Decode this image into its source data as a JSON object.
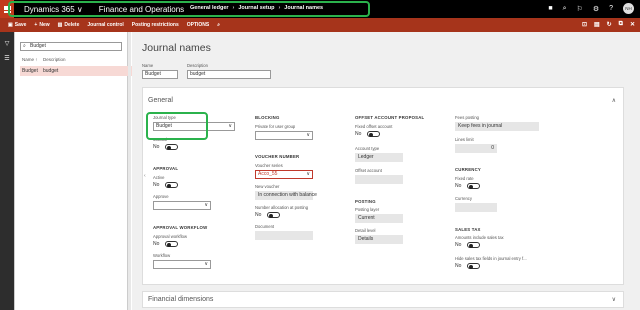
{
  "topbar": {
    "brand": "Dynamics 365",
    "brand_chevron": "∨",
    "module": "Finance and Operations",
    "breadcrumb": [
      "General ledger",
      "Journal setup",
      "Journal names"
    ],
    "avatar": "NH"
  },
  "actionbar": {
    "save": "Save",
    "new": "New",
    "delete": "Delete",
    "journal_control": "Journal control",
    "posting_restrictions": "Posting restrictions",
    "options": "OPTIONS"
  },
  "list": {
    "filter_value": "Budget",
    "col_name": "Name ↑",
    "col_desc": "Description",
    "rows": [
      {
        "name": "Budget",
        "description": "budget"
      }
    ]
  },
  "main": {
    "title": "Journal names",
    "name_label": "Name",
    "name_value": "Budget",
    "desc_label": "Description",
    "desc_value": "budget",
    "general": {
      "title": "General",
      "caret": "∧",
      "journal_type_label": "Journal type",
      "journal_type_value": "Budget",
      "manual_label": "Manual",
      "manual_value": "No",
      "approval_title": "APPROVAL",
      "active_label": "Active",
      "active_value": "No",
      "approve_label": "Approve",
      "approval_workflow_title": "APPROVAL WORKFLOW",
      "approval_workflow_label": "Approval workflow",
      "approval_workflow_value": "No",
      "workflow_label": "Workflow",
      "blocking_title": "BLOCKING",
      "private_label": "Private for user group",
      "voucher_title": "VOUCHER NUMBER",
      "voucher_series_label": "Voucher series",
      "voucher_series_value": "Acco_55",
      "new_voucher_label": "New voucher",
      "new_voucher_value": "In connection with balance",
      "number_alloc_label": "Number allocation at posting",
      "number_alloc_value": "No",
      "document_label": "Document",
      "offset_title": "OFFSET ACCOUNT PROPOSAL",
      "fixed_offset_label": "Fixed offset account",
      "fixed_offset_value": "No",
      "account_type_label": "Account type",
      "account_type_value": "Ledger",
      "offset_account_label": "Offset account",
      "posting_title": "POSTING",
      "posting_layer_label": "Posting layer",
      "posting_layer_value": "Current",
      "detail_level_label": "Detail level",
      "detail_level_value": "Details",
      "fees_label": "Fees posting",
      "fees_value": "Keep fees in journal",
      "lines_limit_label": "Lines limit",
      "lines_limit_value": "0",
      "currency_title": "CURRENCY",
      "fixed_rate_label": "Fixed rate",
      "fixed_rate_value": "No",
      "currency_label": "Currency",
      "sales_tax_title": "SALES TAX",
      "amounts_tax_label": "Amounts include sales tax",
      "amounts_tax_value": "No",
      "hide_tax_label": "Hide sales tax fields in journal entry f...",
      "hide_tax_value": "No"
    },
    "financial_dimensions": {
      "title": "Financial dimensions",
      "caret": "∨"
    }
  },
  "colors": {
    "topbar": "#000000",
    "actionbar": "#a6341b",
    "accent_highlight": "#2bb24c",
    "selected_row": "#f7d9d5"
  }
}
